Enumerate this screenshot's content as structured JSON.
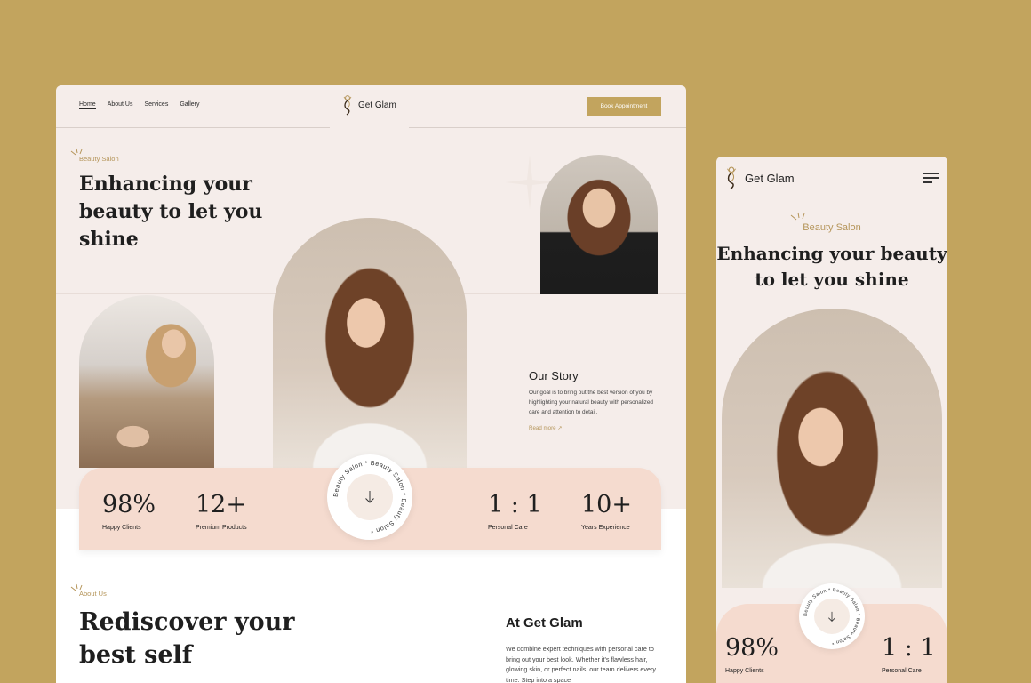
{
  "desktop": {
    "nav": {
      "links": [
        "Home",
        "About Us",
        "Services",
        "Gallery"
      ],
      "brand": "Get Glam",
      "cta": "Book Appointment"
    },
    "hero": {
      "eyebrow": "Beauty Salon",
      "title": "Enhancing your beauty to let you shine"
    },
    "story": {
      "title": "Our Story",
      "text": "Our goal is to bring out the best version of you by highlighting your natural beauty with personalized care and attention to detail.",
      "link": "Read more ↗"
    },
    "stats": [
      {
        "value": "98%",
        "label": "Happy Clients"
      },
      {
        "value": "12+",
        "label": "Premium Products"
      },
      {
        "value": "1 : 1",
        "label": "Personal Care"
      },
      {
        "value": "10+",
        "label": "Years Experience"
      }
    ],
    "badge_text": "Beauty Salon * Beauty Salon * Beauty Salon *",
    "about": {
      "eyebrow": "About Us",
      "title": "Rediscover your best self",
      "heading": "At Get Glam",
      "text": "We combine expert techniques with personal care to bring out your best look. Whether it's flawless hair, glowing skin, or perfect nails, our team delivers every time. Step into a space"
    }
  },
  "mobile": {
    "brand": "Get Glam",
    "eyebrow": "Beauty Salon",
    "title": "Enhancing your beauty to let you shine",
    "badge_text": "Beauty Salon * Beauty Salon * Beauty Salon *",
    "stats": [
      {
        "value": "98%",
        "label": "Happy Clients"
      },
      {
        "value": "1 : 1",
        "label": "Personal Care"
      }
    ]
  },
  "colors": {
    "background": "#c2a45e",
    "panel": "#f5edea",
    "accent": "#b5955a",
    "stats_bar": "#f5dbcf"
  }
}
